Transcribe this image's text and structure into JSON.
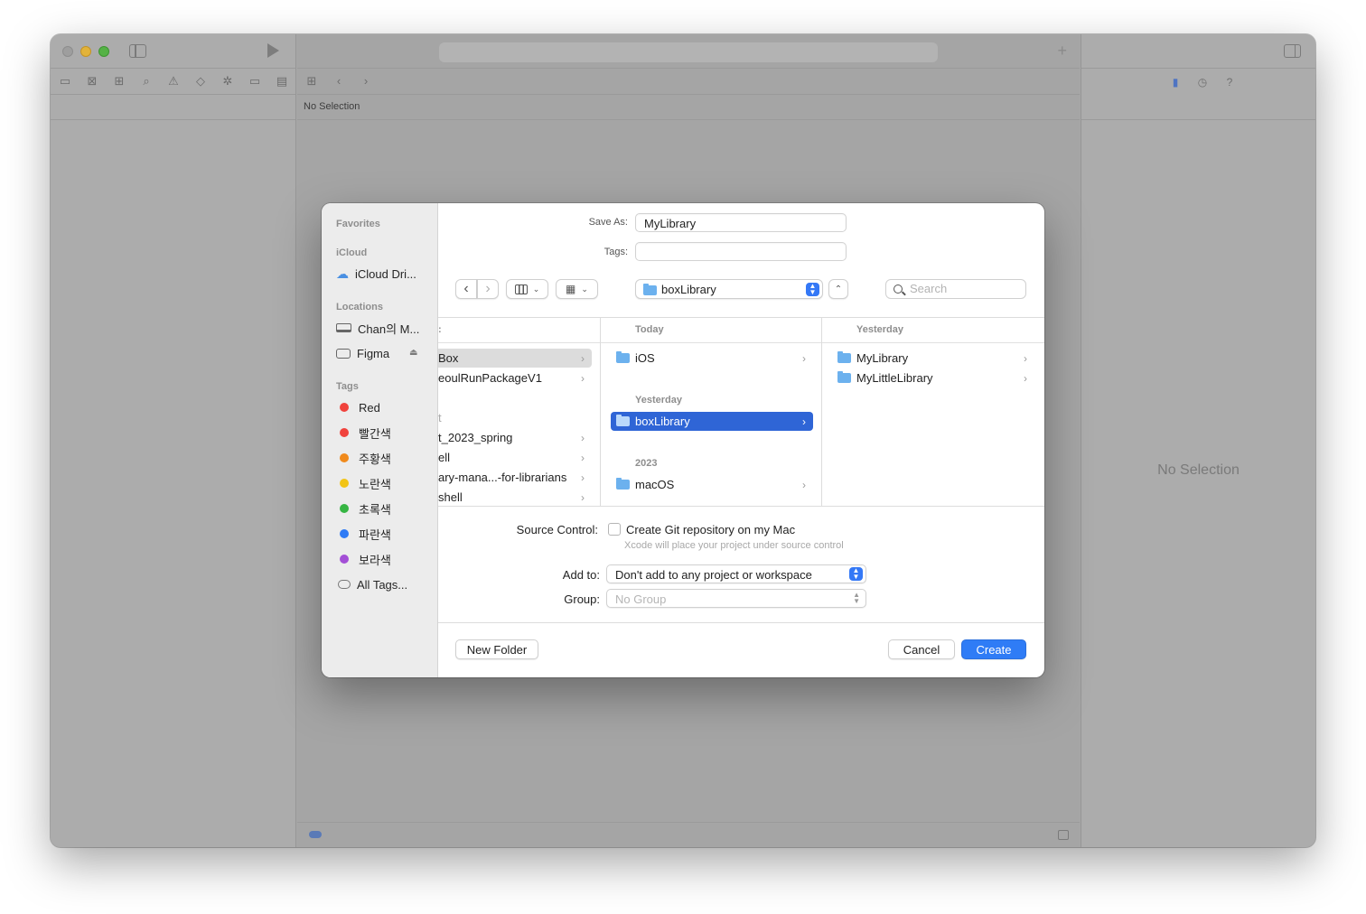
{
  "xcode": {
    "jumpbar_text": "No Selection",
    "inspector_empty": "No Selection"
  },
  "sidebar": {
    "favorites_header": "Favorites",
    "icloud_header": "iCloud",
    "icloud_item": "iCloud Dri...",
    "locations_header": "Locations",
    "location_mac": "Chan의 M...",
    "location_figma": "Figma",
    "tags_header": "Tags",
    "tags": [
      {
        "label": "Red",
        "color": "#f0423c"
      },
      {
        "label": "빨간색",
        "color": "#f0423c"
      },
      {
        "label": "주황색",
        "color": "#f08a1c"
      },
      {
        "label": "노란색",
        "color": "#f2c416"
      },
      {
        "label": "초록색",
        "color": "#36b543"
      },
      {
        "label": "파란색",
        "color": "#2f7bf5"
      },
      {
        "label": "보라색",
        "color": "#a34fd6"
      }
    ],
    "all_tags": "All Tags..."
  },
  "form": {
    "save_as_label": "Save As:",
    "save_as_value": "MyLibrary",
    "tags_label": "Tags:",
    "tags_value": ""
  },
  "toolbar": {
    "path_value": "boxLibrary",
    "search_placeholder": "Search"
  },
  "browser": {
    "col1": {
      "items": [
        {
          "label": "Box",
          "chevron": "›"
        },
        {
          "label": "eoulRunPackageV1",
          "chevron": "›"
        },
        {
          "label": "t",
          "chevron": ""
        },
        {
          "label": "t_2023_spring",
          "chevron": "›"
        },
        {
          "label": "ell",
          "chevron": "›"
        },
        {
          "label": "ary-mana...-for-librarians",
          "chevron": "›"
        },
        {
          "label": "shell",
          "chevron": "›"
        }
      ]
    },
    "col2": {
      "head": "Today",
      "section_yesterday": "Yesterday",
      "section_2023": "2023",
      "items": [
        {
          "label": "iOS",
          "chevron": "›"
        },
        {
          "label": "boxLibrary",
          "chevron": "›"
        },
        {
          "label": "macOS",
          "chevron": "›"
        }
      ]
    },
    "col3": {
      "head": "Yesterday",
      "items": [
        {
          "label": "MyLibrary",
          "chevron": "›"
        },
        {
          "label": "MyLittleLibrary",
          "chevron": "›"
        }
      ]
    }
  },
  "options": {
    "source_control_label": "Source Control:",
    "git_checkbox_label": "Create Git repository on my Mac",
    "git_hint": "Xcode will place your project under source control",
    "add_to_label": "Add to:",
    "add_to_value": "Don't add to any project or workspace",
    "group_label": "Group:",
    "group_value": "No Group"
  },
  "buttons": {
    "new_folder": "New Folder",
    "cancel": "Cancel",
    "create": "Create"
  }
}
